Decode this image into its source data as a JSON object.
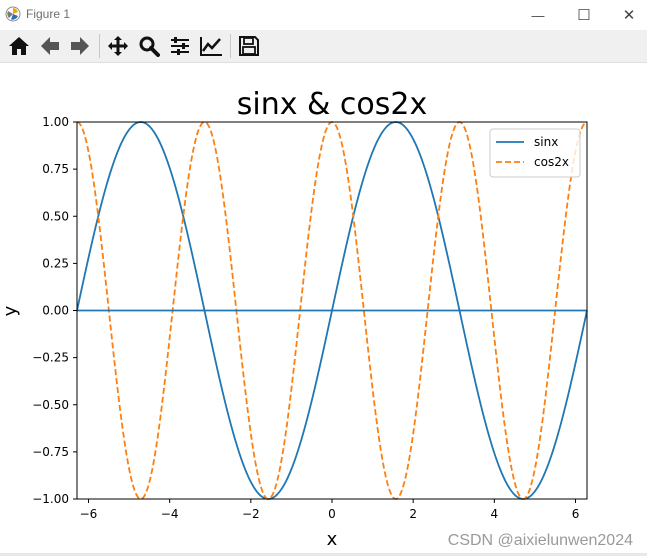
{
  "window": {
    "title": "Figure 1",
    "minimize_glyph": "—",
    "maximize_glyph": "☐",
    "close_glyph": "✕"
  },
  "toolbar": {
    "items": [
      "home-icon",
      "back-arrow-icon",
      "forward-arrow-icon",
      "pan-icon",
      "zoom-icon",
      "subplots-icon",
      "edit-axis-icon",
      "save-icon"
    ]
  },
  "chart_data": {
    "type": "line",
    "title": "sinx & cos2x",
    "xlabel": "x",
    "ylabel": "y",
    "xlim": [
      -6.283,
      6.283
    ],
    "ylim": [
      -1.0,
      1.0
    ],
    "xticks": [
      -6,
      -4,
      -2,
      0,
      2,
      4,
      6
    ],
    "xtick_labels": [
      "−6",
      "−4",
      "−2",
      "0",
      "2",
      "4",
      "6"
    ],
    "yticks": [
      -1.0,
      -0.75,
      -0.5,
      -0.25,
      0.0,
      0.25,
      0.5,
      0.75,
      1.0
    ],
    "ytick_labels": [
      "−1.00",
      "−0.75",
      "−0.50",
      "−0.25",
      "0.00",
      "0.25",
      "0.50",
      "0.75",
      "1.00"
    ],
    "grid": false,
    "legend_position": "top-right",
    "series": [
      {
        "name": "sinx",
        "color": "#1f77b4",
        "style": "solid",
        "x": [
          -6.283,
          -5.498,
          -4.712,
          -3.927,
          -3.142,
          -2.356,
          -1.571,
          -0.785,
          0.0,
          0.785,
          1.571,
          2.356,
          3.142,
          3.927,
          4.712,
          5.498,
          6.283
        ],
        "y": [
          0.0,
          0.707,
          1.0,
          0.707,
          0.0,
          -0.707,
          -1.0,
          -0.707,
          0.0,
          0.707,
          1.0,
          0.707,
          0.0,
          -0.707,
          -1.0,
          -0.707,
          0.0
        ]
      },
      {
        "name": "cos2x",
        "color": "#ff7f0e",
        "style": "dashed",
        "x": [
          -6.283,
          -5.498,
          -4.712,
          -3.927,
          -3.142,
          -2.356,
          -1.571,
          -0.785,
          0.0,
          0.785,
          1.571,
          2.356,
          3.142,
          3.927,
          4.712,
          5.498,
          6.283
        ],
        "y": [
          1.0,
          0.0,
          -1.0,
          0.0,
          1.0,
          0.0,
          -1.0,
          0.0,
          1.0,
          0.0,
          -1.0,
          0.0,
          1.0,
          0.0,
          -1.0,
          0.0,
          1.0
        ]
      },
      {
        "color": "#1f77b4",
        "style": "solid",
        "x": [
          -6.283,
          6.283
        ],
        "y": [
          0.0,
          0.0
        ]
      }
    ]
  },
  "watermark": "CSDN @aixielunwen2024"
}
